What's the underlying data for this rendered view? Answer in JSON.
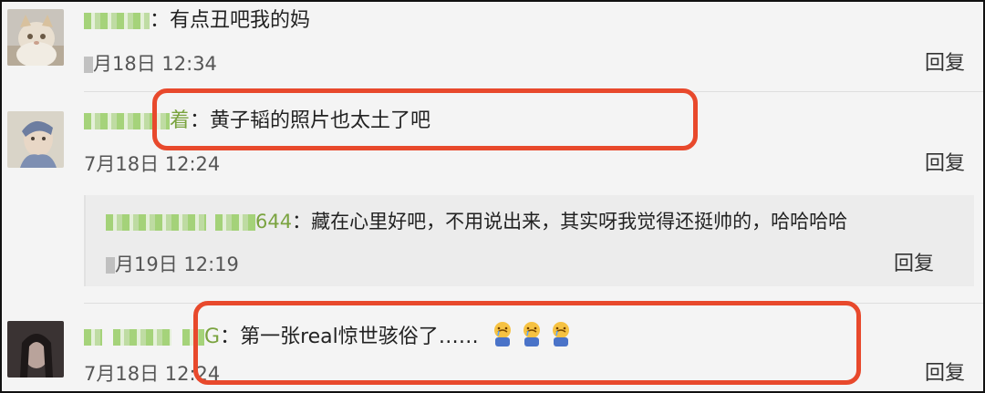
{
  "comments": [
    {
      "name_suffix": "",
      "text": "有点丑吧我的妈",
      "date": "月18日 12:34",
      "reply": "回复"
    },
    {
      "name_suffix": "着",
      "text": "黄子韬的照片也太土了吧",
      "date": "7月18日 12:24",
      "reply": "回复"
    },
    {
      "name_suffix": "644",
      "text": "藏在心里好吧，不用说出来，其实呀我觉得还挺帅的，哈哈哈哈",
      "date": "月19日 12:19",
      "reply": "回复"
    },
    {
      "name_suffix": "G",
      "text": "第一张real惊世骇俗了……",
      "date": "7月18日 12:24",
      "reply": "回复"
    }
  ],
  "separator": "：",
  "colors": {
    "name": "#7aa33f",
    "highlight": "#e8492c",
    "background": "#f4f4f4"
  },
  "icons": [
    "avatar-cat",
    "avatar-drawn-man",
    "avatar-woman",
    "crying-emoji"
  ]
}
